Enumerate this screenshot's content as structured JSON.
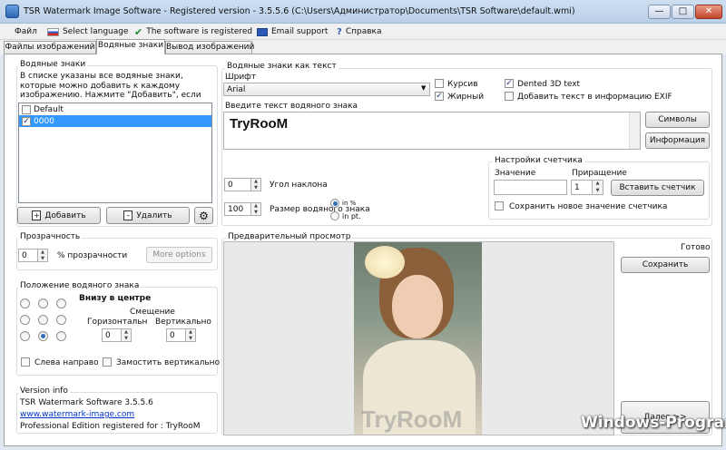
{
  "window": {
    "title": "TSR Watermark Image Software - Registered version - 3.5.5.6 (C:\\Users\\Администратор\\Documents\\TSR Software\\default.wmi)",
    "minimize": "—",
    "maximize": "□",
    "close": "✕"
  },
  "menu": {
    "file": "Файл",
    "select_language": "Select language",
    "registered": "The software is registered",
    "email_support": "Email support",
    "help": "Справка"
  },
  "tabs": [
    {
      "label": "Файлы изображений"
    },
    {
      "label": "Водяные знаки"
    },
    {
      "label": "Вывод изображений"
    }
  ],
  "watermarks": {
    "group_label": "Водяные знаки",
    "description": "В списке указаны все водяные знаки, которые можно добавить к каждому изображению. Нажмите \"Добавить\", если хотите несколько",
    "items": [
      {
        "label": "Default",
        "checked": false,
        "selected": false
      },
      {
        "label": "0000",
        "checked": true,
        "selected": true
      }
    ],
    "add_label": "Добавить",
    "delete_label": "Удалить"
  },
  "transparency": {
    "group_label": "Прозрачность",
    "value": "0",
    "unit_label": "% прозрачности",
    "more_options": "More options"
  },
  "position": {
    "group_label": "Положение водяного знака",
    "current": "Внизу в центре",
    "offset_label": "Смещение",
    "horizontal_label": "Горизонтальн",
    "vertical_label": "Вертикально",
    "horizontal_value": "0",
    "vertical_value": "0",
    "selected_index": 7,
    "rtl_label": "Слева направо",
    "tile_label": "Замостить вертикально"
  },
  "version_info": {
    "group_label": "Version info",
    "line1": "TSR Watermark Software 3.5.5.6",
    "link": "www.watermark-image.com",
    "line3": "Professional Edition registered for : TryRooM"
  },
  "text_watermark": {
    "group_label": "Водяные знаки как текст",
    "font_label": "Шрифт",
    "font_value": "Arial",
    "italic_label": "Курсив",
    "italic": false,
    "bold_label": "Жирный",
    "bold": true,
    "dented_label": "Dented 3D text",
    "dented": true,
    "exif_label": "Добавить текст в информацию EXIF",
    "exif": false,
    "enter_text_label": "Введите текст водяного знака",
    "text_value": "TryRooM",
    "symbols_button": "Символы",
    "info_button": "Информация",
    "angle_value": "0",
    "angle_label": "Угол наклона",
    "size_value": "100",
    "size_label": "Размер водяного знака",
    "unit_percent": "in %",
    "unit_pt": "in pt."
  },
  "counter": {
    "group_label": "Настройки счетчика",
    "value_label": "Значение",
    "value": "",
    "increment_label": "Приращение",
    "increment_value": "1",
    "insert_button": "Вставить счетчик",
    "save_label": "Сохранить новое значение счетчика"
  },
  "preview": {
    "group_label": "Предварительный просмотр",
    "status": "Готово",
    "save_button": "Сохранить",
    "next_button": "Далее >>",
    "watermark_text": "TryRooM"
  },
  "overlay": {
    "site_watermark": "Windows-Program"
  }
}
